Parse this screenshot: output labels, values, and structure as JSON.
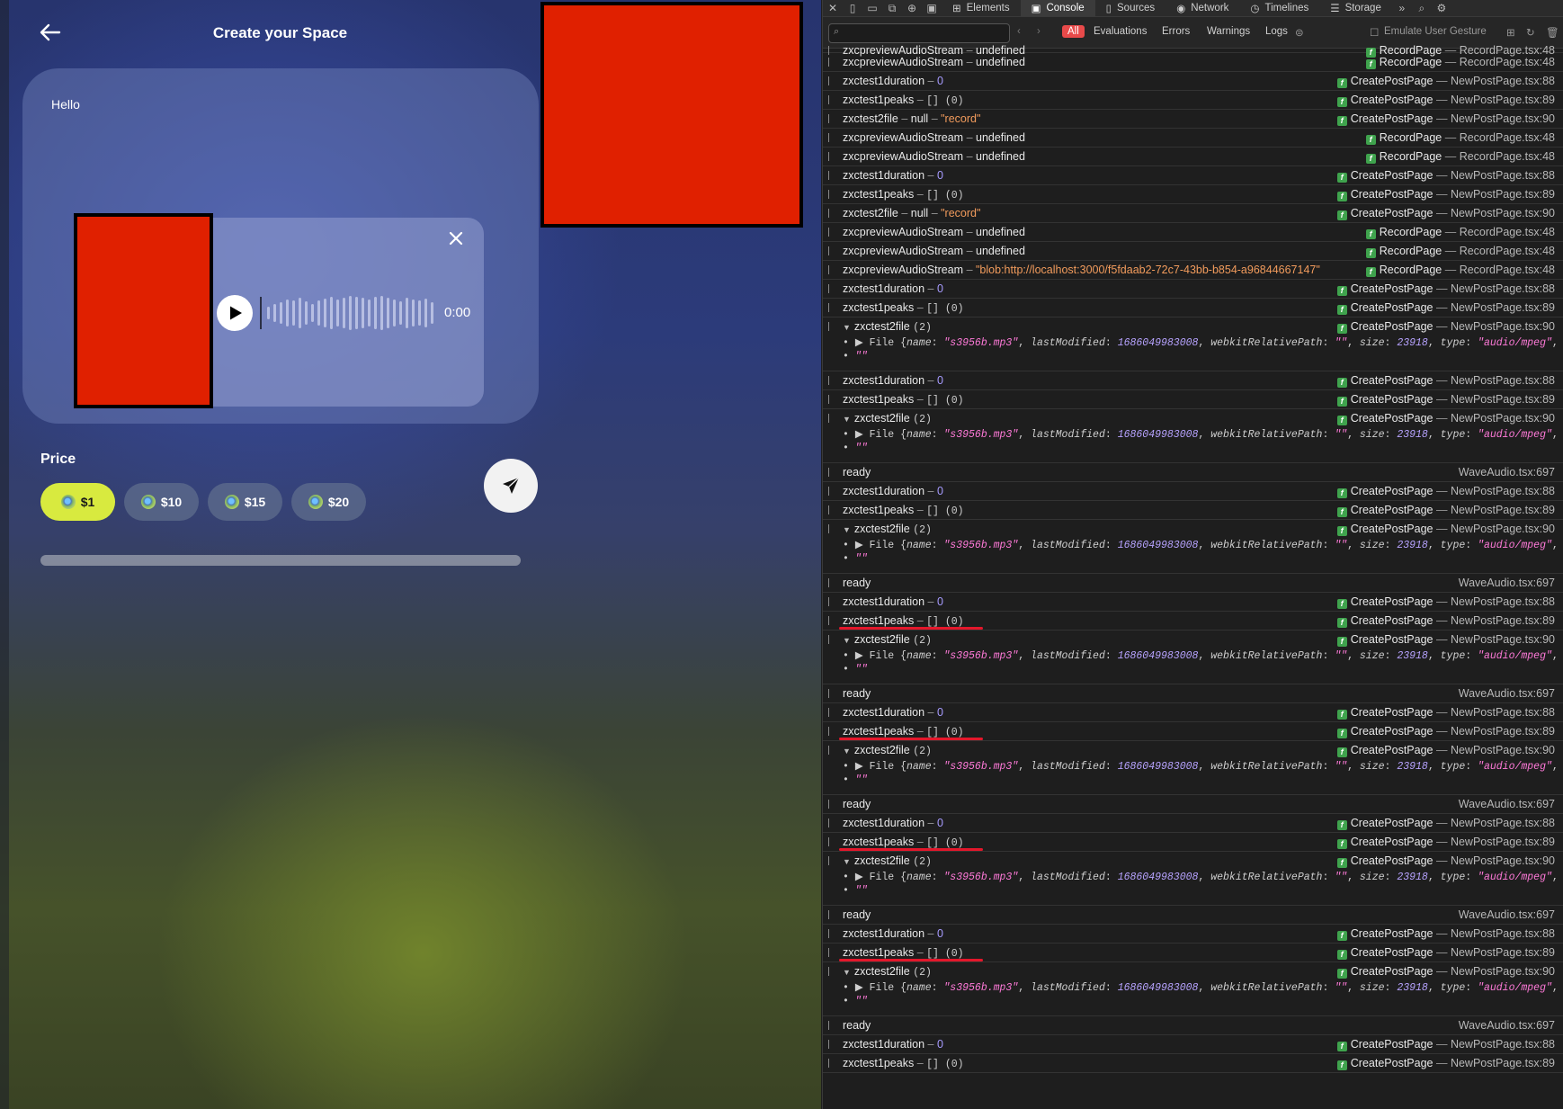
{
  "app": {
    "title": "Create your Space",
    "text": "Hello",
    "player": {
      "time": "0:00"
    },
    "price_label": "Price",
    "prices": [
      {
        "label": "$1",
        "selected": true
      },
      {
        "label": "$10",
        "selected": false
      },
      {
        "label": "$15",
        "selected": false
      },
      {
        "label": "$20",
        "selected": false
      }
    ],
    "colors": {
      "accent": "#d8ea3f",
      "redacted": "#e02000"
    }
  },
  "devtools": {
    "tabs": [
      "Elements",
      "Console",
      "Sources",
      "Network",
      "Timelines",
      "Storage"
    ],
    "active_tab": "Console",
    "filters": [
      "All",
      "Evaluations",
      "Errors",
      "Warnings",
      "Logs"
    ],
    "emulate_label": "Emulate User Gesture",
    "logs": [
      {
        "type": "simple",
        "name": "zxcpreviewAudioStream",
        "val": "undefined",
        "vt": "plain",
        "fn": "RecordPage",
        "file": "RecordPage.tsx:48",
        "cut": true
      },
      {
        "type": "simple",
        "name": "zxcpreviewAudioStream",
        "val": "undefined",
        "vt": "plain",
        "fn": "RecordPage",
        "file": "RecordPage.tsx:48"
      },
      {
        "type": "simple",
        "name": "zxctest1duration",
        "val": "0",
        "vt": "num",
        "fn": "CreatePostPage",
        "file": "NewPostPage.tsx:88"
      },
      {
        "type": "simple",
        "name": "zxctest1peaks",
        "val": "[] (0)",
        "vt": "mono",
        "fn": "CreatePostPage",
        "file": "NewPostPage.tsx:89"
      },
      {
        "type": "pair",
        "name": "zxctest2file",
        "val": "null",
        "val2": "\"record\"",
        "fn": "CreatePostPage",
        "file": "NewPostPage.tsx:90"
      },
      {
        "type": "simple",
        "name": "zxcpreviewAudioStream",
        "val": "undefined",
        "vt": "plain",
        "fn": "RecordPage",
        "file": "RecordPage.tsx:48"
      },
      {
        "type": "simple",
        "name": "zxcpreviewAudioStream",
        "val": "undefined",
        "vt": "plain",
        "fn": "RecordPage",
        "file": "RecordPage.tsx:48"
      },
      {
        "type": "simple",
        "name": "zxctest1duration",
        "val": "0",
        "vt": "num",
        "fn": "CreatePostPage",
        "file": "NewPostPage.tsx:88"
      },
      {
        "type": "simple",
        "name": "zxctest1peaks",
        "val": "[] (0)",
        "vt": "mono",
        "fn": "CreatePostPage",
        "file": "NewPostPage.tsx:89"
      },
      {
        "type": "pair",
        "name": "zxctest2file",
        "val": "null",
        "val2": "\"record\"",
        "fn": "CreatePostPage",
        "file": "NewPostPage.tsx:90"
      },
      {
        "type": "simple",
        "name": "zxcpreviewAudioStream",
        "val": "undefined",
        "vt": "plain",
        "fn": "RecordPage",
        "file": "RecordPage.tsx:48"
      },
      {
        "type": "simple",
        "name": "zxcpreviewAudioStream",
        "val": "undefined",
        "vt": "plain",
        "fn": "RecordPage",
        "file": "RecordPage.tsx:48"
      },
      {
        "type": "simple",
        "name": "zxcpreviewAudioStream",
        "val": "\"blob:http://localhost:3000/f5fdaab2-72c7-43bb-b854-a96844667147\"",
        "vt": "str",
        "fn": "RecordPage",
        "file": "RecordPage.tsx:48"
      },
      {
        "type": "simple",
        "name": "zxctest1duration",
        "val": "0",
        "vt": "num",
        "fn": "CreatePostPage",
        "file": "NewPostPage.tsx:88"
      },
      {
        "type": "simple",
        "name": "zxctest1peaks",
        "val": "[] (0)",
        "vt": "mono",
        "fn": "CreatePostPage",
        "file": "NewPostPage.tsx:89"
      },
      {
        "type": "file",
        "name": "zxctest2file",
        "count": "(2)",
        "fn": "CreatePostPage",
        "file": "NewPostPage.tsx:90"
      },
      {
        "type": "simple",
        "name": "zxctest1duration",
        "val": "0",
        "vt": "num",
        "fn": "CreatePostPage",
        "file": "NewPostPage.tsx:88"
      },
      {
        "type": "simple",
        "name": "zxctest1peaks",
        "val": "[] (0)",
        "vt": "mono",
        "fn": "CreatePostPage",
        "file": "NewPostPage.tsx:89"
      },
      {
        "type": "file",
        "name": "zxctest2file",
        "count": "(2)",
        "fn": "CreatePostPage",
        "file": "NewPostPage.tsx:90"
      },
      {
        "type": "ready",
        "name": "ready",
        "file": "WaveAudio.tsx:697"
      },
      {
        "type": "simple",
        "name": "zxctest1duration",
        "val": "0",
        "vt": "num",
        "fn": "CreatePostPage",
        "file": "NewPostPage.tsx:88"
      },
      {
        "type": "simple",
        "name": "zxctest1peaks",
        "val": "[] (0)",
        "vt": "mono",
        "fn": "CreatePostPage",
        "file": "NewPostPage.tsx:89"
      },
      {
        "type": "file",
        "name": "zxctest2file",
        "count": "(2)",
        "fn": "CreatePostPage",
        "file": "NewPostPage.tsx:90"
      },
      {
        "type": "ready",
        "name": "ready",
        "file": "WaveAudio.tsx:697"
      },
      {
        "type": "simple",
        "name": "zxctest1duration",
        "val": "0",
        "vt": "num",
        "fn": "CreatePostPage",
        "file": "NewPostPage.tsx:88"
      },
      {
        "type": "simple",
        "name": "zxctest1peaks",
        "val": "[] (0)",
        "vt": "mono",
        "fn": "CreatePostPage",
        "file": "NewPostPage.tsx:89",
        "mark": true
      },
      {
        "type": "file",
        "name": "zxctest2file",
        "count": "(2)",
        "fn": "CreatePostPage",
        "file": "NewPostPage.tsx:90"
      },
      {
        "type": "ready",
        "name": "ready",
        "file": "WaveAudio.tsx:697"
      },
      {
        "type": "simple",
        "name": "zxctest1duration",
        "val": "0",
        "vt": "num",
        "fn": "CreatePostPage",
        "file": "NewPostPage.tsx:88"
      },
      {
        "type": "simple",
        "name": "zxctest1peaks",
        "val": "[] (0)",
        "vt": "mono",
        "fn": "CreatePostPage",
        "file": "NewPostPage.tsx:89",
        "mark": true
      },
      {
        "type": "file",
        "name": "zxctest2file",
        "count": "(2)",
        "fn": "CreatePostPage",
        "file": "NewPostPage.tsx:90"
      },
      {
        "type": "ready",
        "name": "ready",
        "file": "WaveAudio.tsx:697"
      },
      {
        "type": "simple",
        "name": "zxctest1duration",
        "val": "0",
        "vt": "num",
        "fn": "CreatePostPage",
        "file": "NewPostPage.tsx:88"
      },
      {
        "type": "simple",
        "name": "zxctest1peaks",
        "val": "[] (0)",
        "vt": "mono",
        "fn": "CreatePostPage",
        "file": "NewPostPage.tsx:89",
        "mark": true
      },
      {
        "type": "file",
        "name": "zxctest2file",
        "count": "(2)",
        "fn": "CreatePostPage",
        "file": "NewPostPage.tsx:90"
      },
      {
        "type": "ready",
        "name": "ready",
        "file": "WaveAudio.tsx:697"
      },
      {
        "type": "simple",
        "name": "zxctest1duration",
        "val": "0",
        "vt": "num",
        "fn": "CreatePostPage",
        "file": "NewPostPage.tsx:88"
      },
      {
        "type": "simple",
        "name": "zxctest1peaks",
        "val": "[] (0)",
        "vt": "mono",
        "fn": "CreatePostPage",
        "file": "NewPostPage.tsx:89",
        "mark": true
      },
      {
        "type": "file",
        "name": "zxctest2file",
        "count": "(2)",
        "fn": "CreatePostPage",
        "file": "NewPostPage.tsx:90"
      },
      {
        "type": "ready",
        "name": "ready",
        "file": "WaveAudio.tsx:697"
      },
      {
        "type": "simple",
        "name": "zxctest1duration",
        "val": "0",
        "vt": "num",
        "fn": "CreatePostPage",
        "file": "NewPostPage.tsx:88"
      },
      {
        "type": "simple",
        "name": "zxctest1peaks",
        "val": "[] (0)",
        "vt": "mono",
        "fn": "CreatePostPage",
        "file": "NewPostPage.tsx:89"
      }
    ],
    "file_entry": {
      "prefix": "File",
      "props": [
        {
          "k": "name",
          "v": "\"s3956b.mp3\"",
          "t": "str"
        },
        {
          "k": "lastModified",
          "v": "1686049983008",
          "t": "num"
        },
        {
          "k": "webkitRelativePath",
          "v": "\"\"",
          "t": "str"
        },
        {
          "k": "size",
          "v": "23918",
          "t": "num"
        },
        {
          "k": "type",
          "v": "\"audio/mpeg\"",
          "t": "str"
        }
      ],
      "tail": "…}",
      "empty": "\"\""
    }
  }
}
